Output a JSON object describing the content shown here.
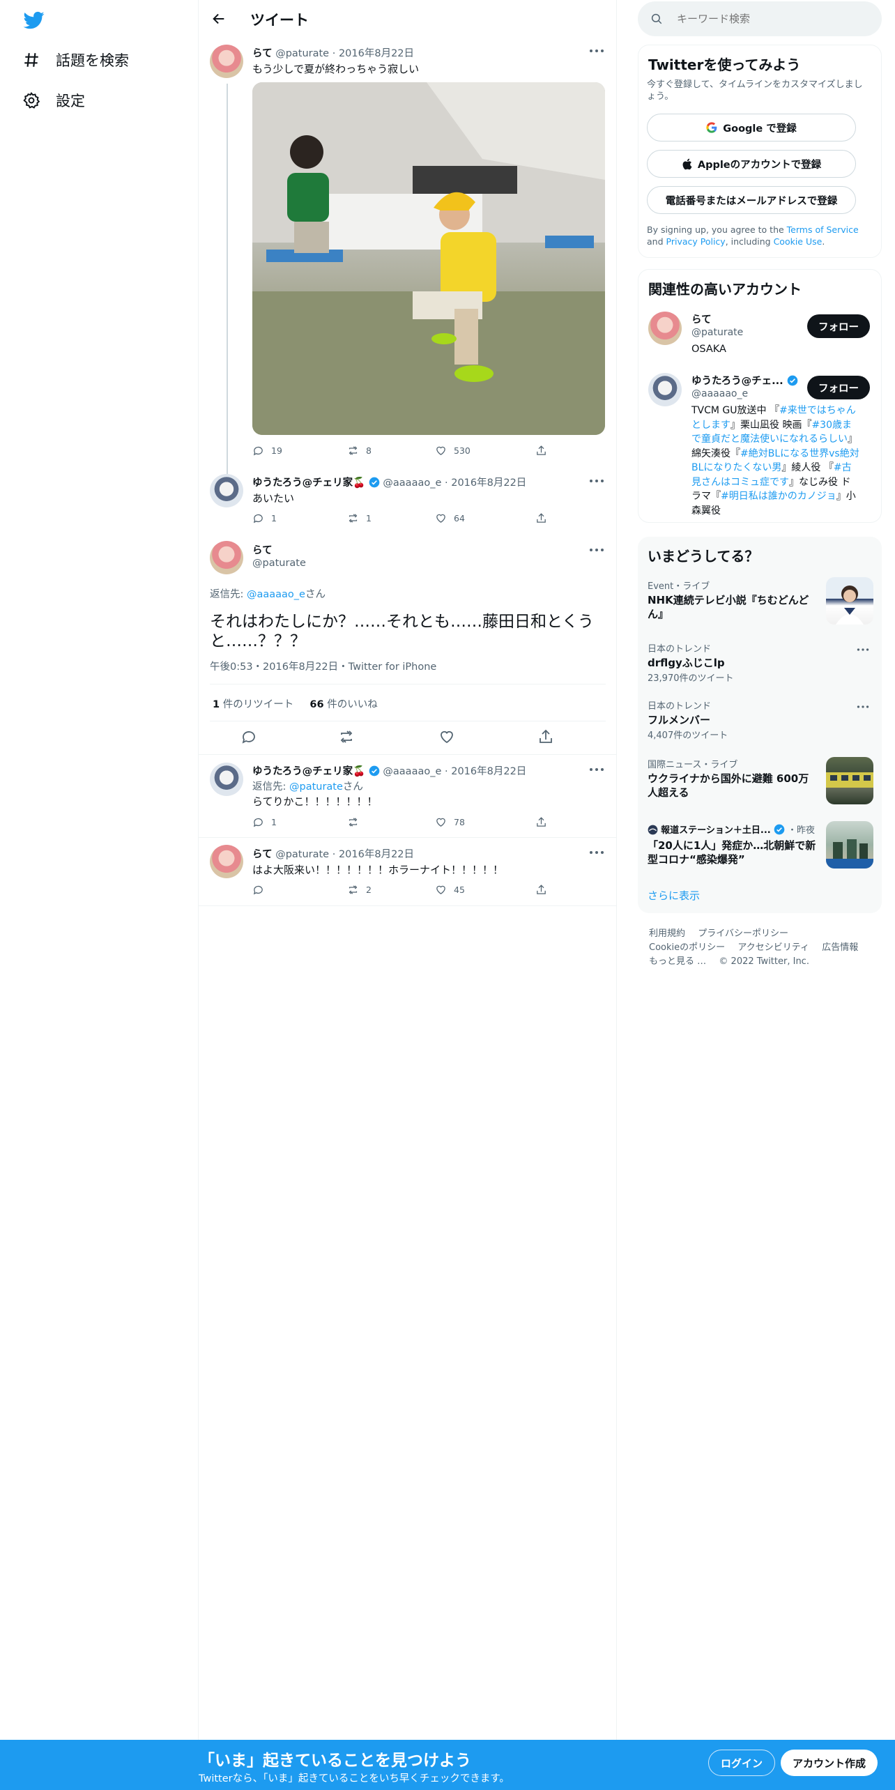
{
  "nav": {
    "explore_label": "話題を検索",
    "settings_label": "設定"
  },
  "header": {
    "title": "ツイート"
  },
  "thread": {
    "tweet1": {
      "name": "らて",
      "handle": "@paturate",
      "date": "2016年8月22日",
      "text": "もう少しで夏が終わっちゃう寂しい",
      "replies": "19",
      "retweets": "8",
      "likes": "530"
    },
    "tweet2": {
      "name": "ゆうたろう@チェリ家🍒",
      "handle": "@aaaaao_e",
      "date": "2016年8月22日",
      "text": "あいたい",
      "replies": "1",
      "retweets": "1",
      "likes": "64"
    },
    "focus": {
      "name": "らて",
      "handle": "@paturate",
      "reply_prefix": "返信先: ",
      "reply_to": "@aaaaao_e",
      "reply_suffix": "さん",
      "text_line1": "それはわたしにか？……それとも……藤田日和とくう",
      "text_line2": "と……？？？",
      "meta": "午後0:53・2016年8月22日・Twitter for iPhone",
      "retweet_count": "1",
      "retweet_label": " 件のリツイート",
      "like_count": "66",
      "like_label": " 件のいいね"
    },
    "reply1": {
      "name": "ゆうたろう@チェリ家🍒",
      "handle": "@aaaaao_e",
      "date": "2016年8月22日",
      "reply_prefix": "返信先: ",
      "reply_to": "@paturate",
      "reply_suffix": "さん",
      "text": "らてりかこ！！！！！！！",
      "replies": "1",
      "retweets": "",
      "likes": "78"
    },
    "reply2": {
      "name": "らて",
      "handle": "@paturate",
      "date": "2016年8月22日",
      "text": "はよ大阪来い！！！！！！！ホラーナイト！！！！！",
      "replies": "",
      "retweets": "2",
      "likes": "45"
    }
  },
  "search": {
    "placeholder": "キーワード検索"
  },
  "signup": {
    "title": "Twitterを使ってみよう",
    "subtitle": "今すぐ登録して、タイムラインをカスタマイズしましょう。",
    "google_label": "Google で登録",
    "apple_label": "Appleのアカウントで登録",
    "phone_label": "電話番号またはメールアドレスで登録",
    "terms_prefix": "By signing up, you agree to the ",
    "terms_link": "Terms of Service",
    "terms_and": " and",
    "privacy_link": "Privacy Policy",
    "including": ", including ",
    "cookie_link": "Cookie Use",
    "period": "."
  },
  "related": {
    "title": "関連性の高いアカウント",
    "follow_label": "フォロー",
    "accounts": [
      {
        "name": "らて",
        "handle": "@paturate",
        "bio": "OSAKA"
      },
      {
        "name": "ゆうたろう@チェ...",
        "handle": "@aaaaao_e",
        "bio_lines": [
          [
            "TVCM GU放送中 『",
            "#来世ではちゃん"
          ],
          [
            "とします",
            "』栗山凪役 映画『",
            "#30歳ま"
          ],
          [
            "で童貞だと魔法使いになれるらしい",
            "』"
          ],
          [
            "綿矢湊役『",
            "#絶対BLになる世界vs絶対"
          ],
          [
            "BLになりたくない男",
            "』綾人役 『",
            "#古"
          ],
          [
            "見さんはコミュ症です",
            "』なじみ役 ド"
          ],
          [
            "ラマ『",
            "#明日私は誰かのカノジョ",
            "』小"
          ],
          [
            "森翼役"
          ]
        ]
      }
    ]
  },
  "trends": {
    "title": "いまどうしてる？",
    "items": [
      {
        "meta": "Event・ライブ",
        "title_line1": "NHK連続テレビ小説『ちむどんど",
        "title_line2": "ん』"
      },
      {
        "meta": "日本のトレンド",
        "title_line1": "drflgyふじこlp",
        "count": "23,970件のツイート"
      },
      {
        "meta": "日本のトレンド",
        "title_line1": "フルメンバー",
        "count": "4,407件のツイート"
      },
      {
        "meta": "国際ニュース・ライブ",
        "title_line1": "ウクライナから国外に避難 600万",
        "title_line2": "人超える"
      },
      {
        "meta": "報道ステーション＋土日...",
        "meta_time": "・昨夜",
        "title_line1": "「20人に1人」発症か…北朝鮮で新",
        "title_line2": "型コロナ“感染爆発”"
      }
    ],
    "show_more": "さらに表示"
  },
  "footer": {
    "row1": [
      "利用規約",
      "プライバシーポリシー"
    ],
    "row2": [
      "Cookieのポリシー",
      "アクセシビリティ",
      "広告情報"
    ],
    "row3": [
      "もっと見る …",
      "© 2022 Twitter, Inc."
    ]
  },
  "bottom_bar": {
    "title": "「いま」起きていることを見つけよう",
    "subtitle": "Twitterなら、「いま」起きていることをいち早くチェックできます。",
    "login_label": "ログイン",
    "signup_label": "アカウント作成"
  },
  "colors": {
    "accent": "#1d9bf0",
    "text": "#0f1419",
    "muted": "#536471",
    "border": "#eff3f4"
  }
}
